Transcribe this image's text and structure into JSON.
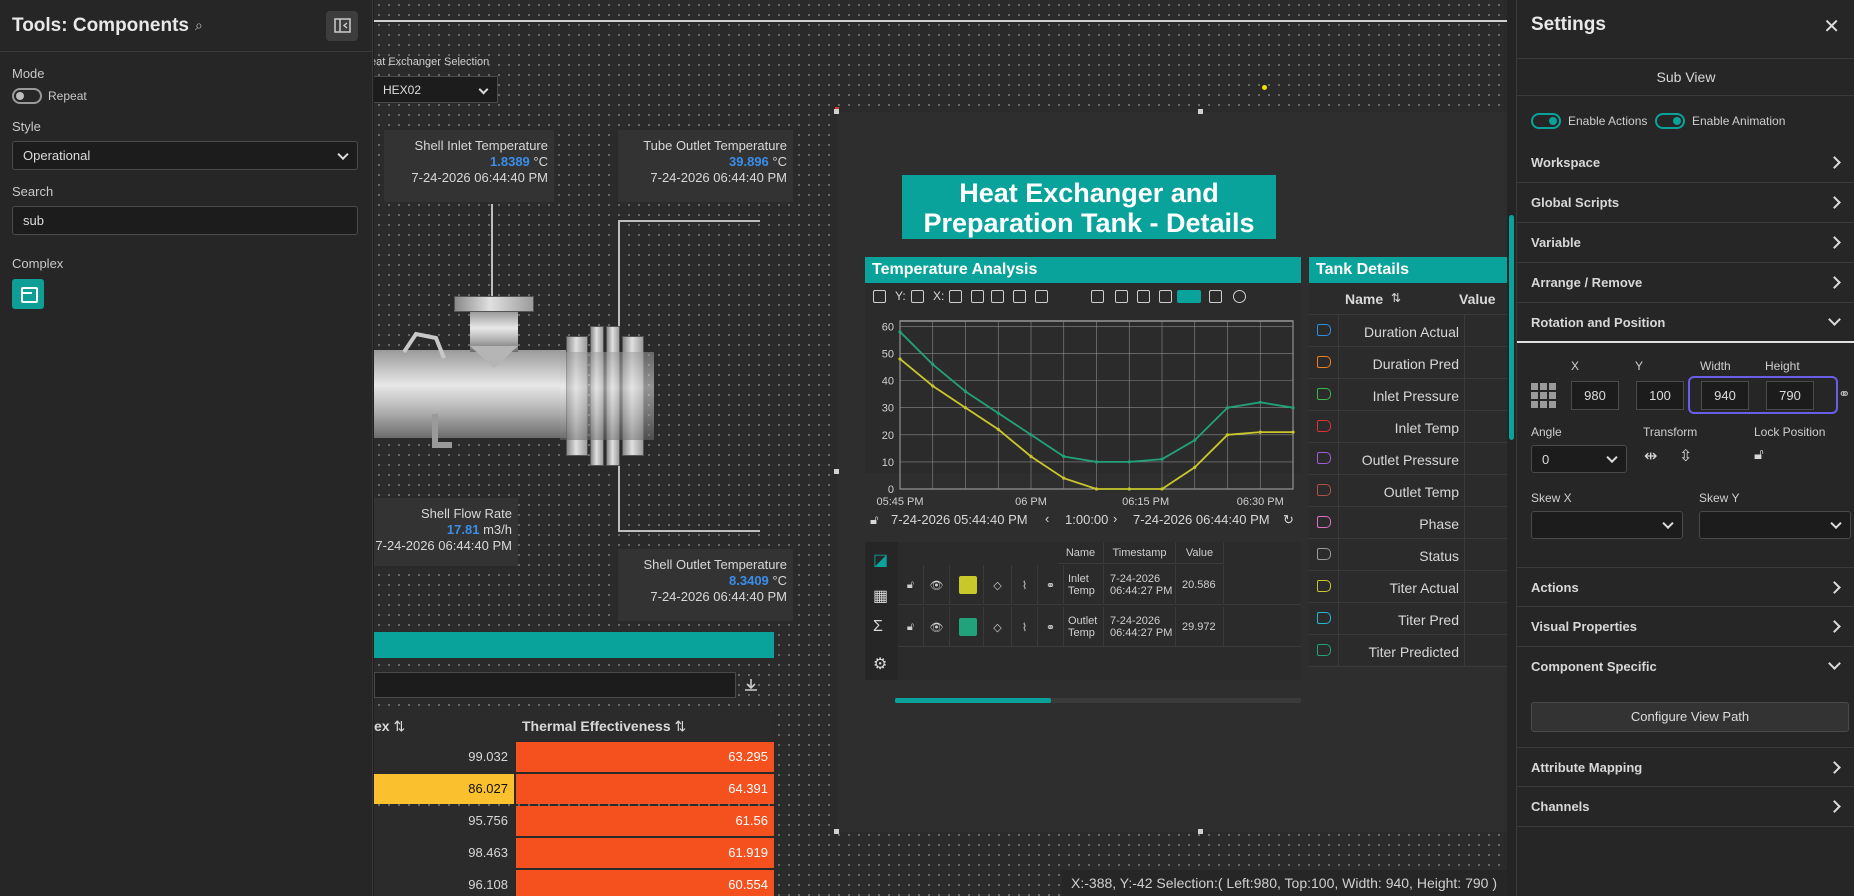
{
  "left_panel": {
    "title": "Tools: Components",
    "mode_label": "Mode",
    "repeat_label": "Repeat",
    "style_label": "Style",
    "style_value": "Operational",
    "search_label": "Search",
    "search_value": "sub",
    "complex_label": "Complex"
  },
  "canvas": {
    "hex_selection_label": "eat Exchanger Selection",
    "hex_selection_value": "HEX02",
    "readouts": {
      "shell_inlet": {
        "label": "Shell Inlet Temperature",
        "value": "1.8389",
        "unit": "°C",
        "time": "7-24-2026 06:44:40 PM"
      },
      "tube_outlet": {
        "label": "Tube Outlet Temperature",
        "value": "39.896",
        "unit": "°C",
        "time": "7-24-2026 06:44:40 PM"
      },
      "shell_flow": {
        "label": "Shell Flow Rate",
        "value": "17.81",
        "unit": "m3/h",
        "time": "7-24-2026 06:44:40 PM"
      },
      "shell_outlet": {
        "label": "Shell Outlet Temperature",
        "value": "8.3409",
        "unit": "°C",
        "time": "7-24-2026 06:44:40 PM"
      }
    },
    "lower_table": {
      "col1_header": "ex",
      "col2_header": "Thermal Effectiveness",
      "rows": [
        {
          "c1": "99.032",
          "c2": "63.295",
          "c1_color": "#2b2b2b"
        },
        {
          "c1": "86.027",
          "c2": "64.391",
          "c1_color": "#fbc02d"
        },
        {
          "c1": "95.756",
          "c2": "61.56",
          "c1_color": "#2b2b2b"
        },
        {
          "c1": "98.463",
          "c2": "61.919",
          "c1_color": "#2b2b2b"
        },
        {
          "c1": "96.108",
          "c2": "60.554",
          "c1_color": "#2b2b2b"
        }
      ],
      "c2_color": "#f4511e"
    },
    "status_bar": "X:-388, Y:-42  Selection:( Left:980, Top:100, Width: 940, Height: 790 )"
  },
  "subview": {
    "title_line1": "Heat Exchanger and",
    "title_line2": "Preparation Tank - Details",
    "temperature_analysis_title": "Temperature Analysis",
    "toolbar_y": "Y:",
    "toolbar_x": "X:",
    "range_start": "7-24-2026 05:44:40 PM",
    "range_duration": "1:00:00",
    "range_end": "7-24-2026 06:44:40 PM",
    "legend_headers": [
      "Name",
      "Timestamp",
      "Value"
    ],
    "legend_rows": [
      {
        "name_l1": "Inlet",
        "name_l2": "Temp",
        "ts_l1": "7-24-2026",
        "ts_l2": "06:44:27 PM",
        "value": "20.586",
        "color": "#c8c82a"
      },
      {
        "name_l1": "Outlet",
        "name_l2": "Temp",
        "ts_l1": "7-24-2026",
        "ts_l2": "06:44:27 PM",
        "value": "29.972",
        "color": "#21a27a"
      }
    ],
    "tank_details_title": "Tank Details",
    "tank_col_name": "Name",
    "tank_col_value": "Value",
    "tank_rows": [
      {
        "name": "Duration Actual",
        "color": "#2e8fe0"
      },
      {
        "name": "Duration Pred",
        "color": "#f0801e"
      },
      {
        "name": "Inlet Pressure",
        "color": "#3ab84a"
      },
      {
        "name": "Inlet Temp",
        "color": "#e03030"
      },
      {
        "name": "Outlet Pressure",
        "color": "#9a5ed8"
      },
      {
        "name": "Outlet Temp",
        "color": "#b0504a"
      },
      {
        "name": "Phase",
        "color": "#e070c0"
      },
      {
        "name": "Status",
        "color": "#9a9a9a"
      },
      {
        "name": "Titer Actual",
        "color": "#c8c82a"
      },
      {
        "name": "Titer Pred",
        "color": "#22b8d8"
      },
      {
        "name": "Titer Predicted",
        "color": "#21a27a"
      }
    ]
  },
  "chart_data": {
    "type": "line",
    "x": [
      "05:45 PM",
      "05:50 PM",
      "05:55 PM",
      "06:00 PM",
      "06:05 PM",
      "06:10 PM",
      "06:15 PM",
      "06:20 PM",
      "06:25 PM",
      "06:30 PM",
      "06:35 PM",
      "06:40 PM",
      "06:44 PM"
    ],
    "x_ticks": [
      "05:45 PM",
      "06 PM",
      "06:15 PM",
      "06:30 PM"
    ],
    "y_ticks": [
      0,
      10,
      20,
      30,
      40,
      50,
      60
    ],
    "ylim": [
      0,
      62
    ],
    "series": [
      {
        "name": "Inlet Temp",
        "color": "#c8c82a",
        "values": [
          48,
          38,
          30,
          22,
          12,
          4,
          0,
          0,
          0,
          8,
          20,
          21,
          21
        ]
      },
      {
        "name": "Outlet Temp",
        "color": "#21a27a",
        "values": [
          58,
          46,
          36,
          28,
          20,
          12,
          10,
          10,
          11,
          18,
          30,
          32,
          30
        ]
      }
    ],
    "grid": true
  },
  "settings": {
    "title": "Settings",
    "subview_label": "Sub View",
    "enable_actions": "Enable Actions",
    "enable_animation": "Enable Animation",
    "sections_top": [
      "Workspace",
      "Global Scripts",
      "Variable",
      "Arrange / Remove",
      "Rotation and Position"
    ],
    "x_label": "X",
    "y_label": "Y",
    "width_label": "Width",
    "height_label": "Height",
    "x_value": "980",
    "y_value": "100",
    "width_value": "940",
    "height_value": "790",
    "angle_label": "Angle",
    "angle_value": "0",
    "transform_label": "Transform",
    "lock_label": "Lock Position",
    "skewx_label": "Skew X",
    "skewy_label": "Skew Y",
    "sections_bottom": [
      "Actions",
      "Visual Properties",
      "Component Specific"
    ],
    "configure_button": "Configure View Path",
    "sections_end": [
      "Attribute Mapping",
      "Channels"
    ]
  }
}
